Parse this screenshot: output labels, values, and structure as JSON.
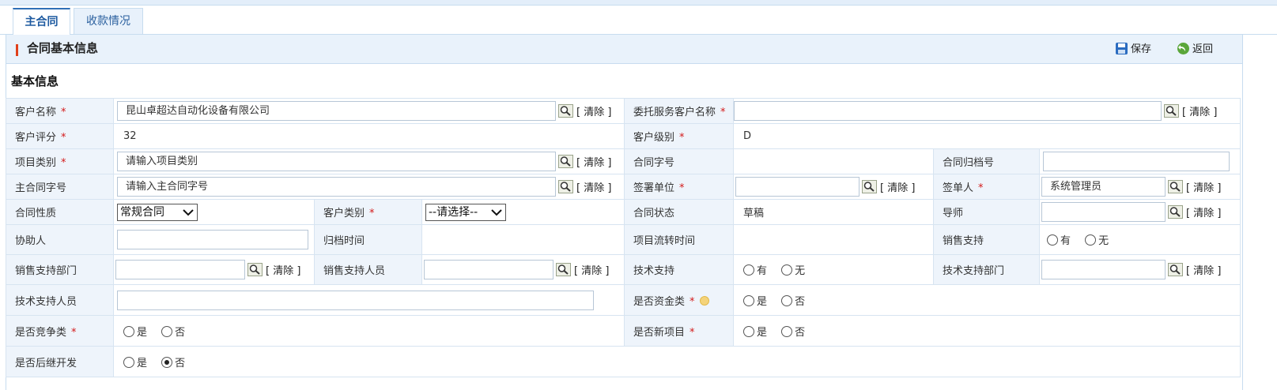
{
  "tabs": [
    {
      "label": "主合同",
      "active": true
    },
    {
      "label": "收款情况",
      "active": false
    }
  ],
  "panel": {
    "title": "合同基本信息",
    "save_label": "保存",
    "back_label": "返回"
  },
  "section_title": "基本信息",
  "common": {
    "required_mark": "*",
    "clear_label": "[ 清除 ]"
  },
  "fields": {
    "customer_name": {
      "label": "客户名称",
      "value": "昆山卓超达自动化设备有限公司"
    },
    "entrusted_customer": {
      "label": "委托服务客户名称",
      "value": ""
    },
    "customer_rating": {
      "label": "客户评分",
      "value": "32"
    },
    "customer_level": {
      "label": "客户级别",
      "value": "D"
    },
    "project_category": {
      "label": "项目类别",
      "placeholder": "请输入项目类别"
    },
    "contract_no": {
      "label": "合同字号",
      "value": ""
    },
    "archive_no": {
      "label": "合同归档号",
      "value": ""
    },
    "main_contract_no": {
      "label": "主合同字号",
      "placeholder": "请输入主合同字号"
    },
    "signing_unit": {
      "label": "签署单位",
      "value": ""
    },
    "signer": {
      "label": "签单人",
      "value": "系统管理员"
    },
    "contract_nature": {
      "label": "合同性质",
      "selected": "常规合同"
    },
    "customer_type": {
      "label": "客户类别",
      "selected": "--请选择--"
    },
    "contract_status": {
      "label": "合同状态",
      "value": "草稿"
    },
    "mentor": {
      "label": "导师",
      "value": ""
    },
    "assistant": {
      "label": "协助人",
      "value": ""
    },
    "archive_time": {
      "label": "归档时间",
      "value": ""
    },
    "project_flow_time": {
      "label": "项目流转时间",
      "value": ""
    },
    "sales_support": {
      "label": "销售支持",
      "options": [
        "有",
        "无"
      ]
    },
    "sales_support_dept": {
      "label": "销售支持部门",
      "value": ""
    },
    "sales_support_staff": {
      "label": "销售支持人员",
      "value": ""
    },
    "tech_support": {
      "label": "技术支持",
      "options": [
        "有",
        "无"
      ]
    },
    "tech_support_dept": {
      "label": "技术支持部门",
      "value": ""
    },
    "tech_support_staff": {
      "label": "技术支持人员",
      "value": ""
    },
    "is_funding": {
      "label": "是否资金类",
      "options": [
        "是",
        "否"
      ]
    },
    "is_competitive": {
      "label": "是否竞争类",
      "options": [
        "是",
        "否"
      ]
    },
    "is_new_project": {
      "label": "是否新项目",
      "options": [
        "是",
        "否"
      ]
    },
    "is_follow_up": {
      "label": "是否后继开发",
      "options": [
        "是",
        "否"
      ],
      "selected": "否"
    }
  },
  "colors": {
    "accent": "#2f6fb6",
    "label_bg": "#eef4fb",
    "border": "#d7e4f1",
    "required": "#d31919",
    "title_bar": "#e0401a"
  }
}
